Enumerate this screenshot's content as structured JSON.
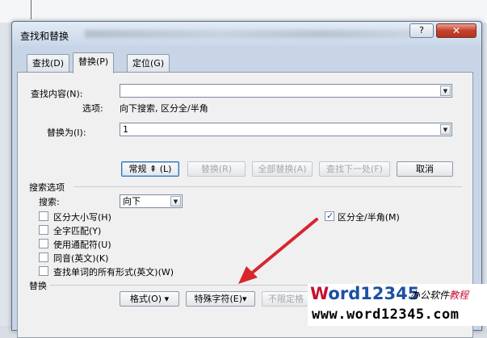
{
  "dialog": {
    "title": "查找和替换",
    "help_glyph": "?",
    "close_glyph": "✕"
  },
  "tabs": [
    {
      "label": "查找(D)",
      "active": false
    },
    {
      "label": "替换(P)",
      "active": true
    },
    {
      "label": "定位(G)",
      "active": false
    }
  ],
  "find": {
    "label": "查找内容(N):",
    "value": "",
    "options_label": "选项:",
    "options_value": "向下搜索, 区分全/半角"
  },
  "replace": {
    "label": "替换为(I):",
    "value": "1"
  },
  "buttons": {
    "less": "常规 ⇞ (L)",
    "replace": "替换(R)",
    "replace_all": "全部替换(A)",
    "find_next": "查找下一处(F)",
    "cancel": "取消"
  },
  "search_options": {
    "title": "搜索选项",
    "search_label": "搜索:",
    "search_value": "向下",
    "checkboxes": [
      {
        "label": "区分大小写(H)",
        "checked": false
      },
      {
        "label": "全字匹配(Y)",
        "checked": false
      },
      {
        "label": "使用通配符(U)",
        "checked": false
      },
      {
        "label": "同音(英文)(K)",
        "checked": false
      },
      {
        "label": "查找单词的所有形式(英文)(W)",
        "checked": false
      }
    ],
    "right_checkbox": {
      "label": "区分全/半角(M)",
      "checked": true
    }
  },
  "replace_section": {
    "title": "替换",
    "format_button": "格式(O) ▾",
    "special_button": "特殊字符(E)▾",
    "no_format_button": "不限定格"
  },
  "watermark": {
    "brand_w": "W",
    "brand_rest": "ord12345",
    "tag_a": "办公软件",
    "tag_b": "教程",
    "url": "www.word12345.com"
  },
  "colors": {
    "arrow": "#d7262c",
    "accent": "#2f72b8"
  }
}
